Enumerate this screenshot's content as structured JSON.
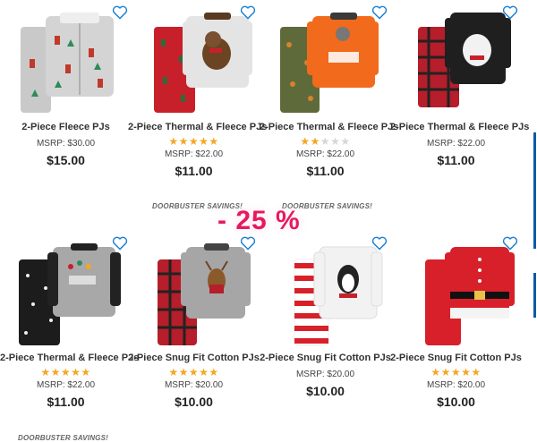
{
  "discount_label": "- 25 %",
  "products": [
    {
      "name": "2-Piece Fleece PJs",
      "rating": 0,
      "msrp": "MSRP: $30.00",
      "price": "$15.00",
      "promo": ""
    },
    {
      "name": "2-Piece Thermal & Fleece PJs",
      "rating": 5,
      "msrp": "MSRP: $22.00",
      "price": "$11.00",
      "promo": "DOORBUSTER SAVINGS!"
    },
    {
      "name": "2-Piece Thermal & Fleece PJs",
      "rating": 2.5,
      "msrp": "MSRP: $22.00",
      "price": "$11.00",
      "promo": "DOORBUSTER SAVINGS!"
    },
    {
      "name": "2-Piece Thermal & Fleece PJs",
      "rating": 0,
      "msrp": "MSRP: $22.00",
      "price": "$11.00",
      "promo": ""
    },
    {
      "name": "2-Piece Thermal & Fleece PJs",
      "rating": 5,
      "msrp": "MSRP: $22.00",
      "price": "$11.00",
      "promo": "DOORBUSTER SAVINGS!"
    },
    {
      "name": "2-Piece Snug Fit Cotton PJs",
      "rating": 5,
      "msrp": "MSRP: $20.00",
      "price": "$10.00",
      "promo": ""
    },
    {
      "name": "2-Piece Snug Fit Cotton PJs",
      "rating": 0,
      "msrp": "MSRP: $20.00",
      "price": "$10.00",
      "promo": ""
    },
    {
      "name": "2-Piece Snug Fit Cotton PJs",
      "rating": 5,
      "msrp": "MSRP: $20.00",
      "price": "$10.00",
      "promo": ""
    }
  ],
  "colors": {
    "accent": "#e8195e",
    "heart": "#1a7fd4",
    "star": "#f5a623"
  }
}
